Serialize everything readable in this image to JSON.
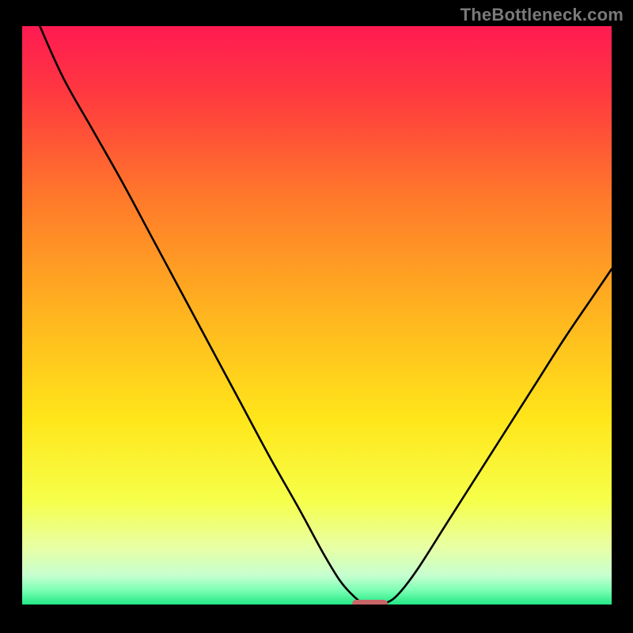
{
  "watermark": "TheBottleneck.com",
  "colors": {
    "page_bg": "#000000",
    "gradient_stops": [
      {
        "offset": 0.0,
        "color": "#ff1a52"
      },
      {
        "offset": 0.12,
        "color": "#ff3a3f"
      },
      {
        "offset": 0.3,
        "color": "#ff7a2a"
      },
      {
        "offset": 0.5,
        "color": "#ffb51f"
      },
      {
        "offset": 0.68,
        "color": "#ffe61a"
      },
      {
        "offset": 0.82,
        "color": "#f6ff4a"
      },
      {
        "offset": 0.9,
        "color": "#e8ffa3"
      },
      {
        "offset": 0.95,
        "color": "#c6ffd0"
      },
      {
        "offset": 0.975,
        "color": "#7dffb5"
      },
      {
        "offset": 1.0,
        "color": "#22e884"
      }
    ],
    "curve_stroke": "#000000",
    "pill": "#c86667"
  },
  "plot": {
    "x_range": [
      0,
      100
    ],
    "y_range": [
      0,
      100
    ]
  },
  "chart_data": {
    "type": "line",
    "title": "",
    "xlabel": "",
    "ylabel": "",
    "x": [
      3,
      7,
      12,
      17,
      22,
      27,
      32,
      37,
      42,
      47,
      51,
      54,
      56.5,
      58,
      60,
      62,
      64,
      67,
      72,
      77,
      82,
      87,
      92,
      97,
      100
    ],
    "values": [
      100,
      91,
      82,
      73,
      63.5,
      54,
      44.5,
      35,
      25.5,
      16.5,
      9,
      4,
      1.2,
      0.2,
      0.2,
      0.4,
      2,
      6,
      14,
      22,
      30,
      38,
      46,
      53.5,
      58
    ],
    "ylim": [
      0,
      100
    ],
    "xlim": [
      0,
      100
    ],
    "notch_x_range": [
      56,
      62
    ],
    "notch_y": 0.2
  }
}
